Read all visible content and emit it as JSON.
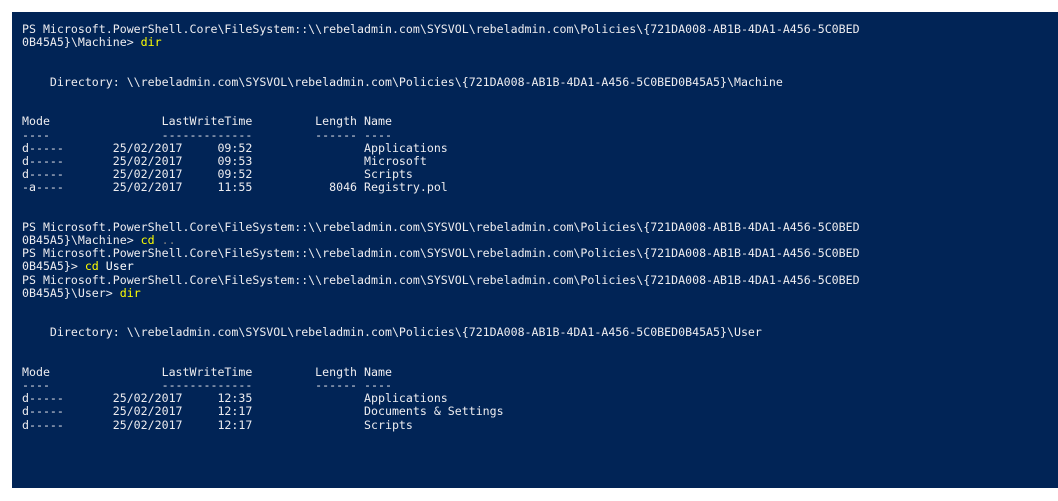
{
  "colors": {
    "background": "#012456",
    "foreground": "#EEEDF0",
    "command": "#FFFF00",
    "operator": "#808080"
  },
  "blocks": [
    {
      "prompt_line1": "PS Microsoft.PowerShell.Core\\FileSystem::\\\\rebeladmin.com\\SYSVOL\\rebeladmin.com\\Policies\\{721DA008-AB1B-4DA1-A456-5C0BED",
      "prompt_line2": "0B45A5}\\Machine> ",
      "cmd": "dir"
    },
    {
      "directory": "    Directory: \\\\rebeladmin.com\\SYSVOL\\rebeladmin.com\\Policies\\{721DA008-AB1B-4DA1-A456-5C0BED0B45A5}\\Machine"
    },
    {
      "header": "Mode                LastWriteTime         Length Name",
      "underline": "----                -------------         ------ ----",
      "rows": [
        "d-----       25/02/2017     09:52                Applications",
        "d-----       25/02/2017     09:53                Microsoft",
        "d-----       25/02/2017     09:52                Scripts",
        "-a----       25/02/2017     11:55           8046 Registry.pol"
      ]
    },
    {
      "prompt_line1": "PS Microsoft.PowerShell.Core\\FileSystem::\\\\rebeladmin.com\\SYSVOL\\rebeladmin.com\\Policies\\{721DA008-AB1B-4DA1-A456-5C0BED",
      "prompt_line2": "0B45A5}\\Machine> ",
      "cmd": "cd",
      "arg": " .."
    },
    {
      "prompt_line1": "PS Microsoft.PowerShell.Core\\FileSystem::\\\\rebeladmin.com\\SYSVOL\\rebeladmin.com\\Policies\\{721DA008-AB1B-4DA1-A456-5C0BED",
      "prompt_line2": "0B45A5}> ",
      "cmd": "cd",
      "arg": " User"
    },
    {
      "prompt_line1": "PS Microsoft.PowerShell.Core\\FileSystem::\\\\rebeladmin.com\\SYSVOL\\rebeladmin.com\\Policies\\{721DA008-AB1B-4DA1-A456-5C0BED",
      "prompt_line2": "0B45A5}\\User> ",
      "cmd": "dir"
    },
    {
      "directory": "    Directory: \\\\rebeladmin.com\\SYSVOL\\rebeladmin.com\\Policies\\{721DA008-AB1B-4DA1-A456-5C0BED0B45A5}\\User"
    },
    {
      "header": "Mode                LastWriteTime         Length Name",
      "underline": "----                -------------         ------ ----",
      "rows": [
        "d-----       25/02/2017     12:35                Applications",
        "d-----       25/02/2017     12:17                Documents & Settings",
        "d-----       25/02/2017     12:17                Scripts"
      ]
    }
  ]
}
